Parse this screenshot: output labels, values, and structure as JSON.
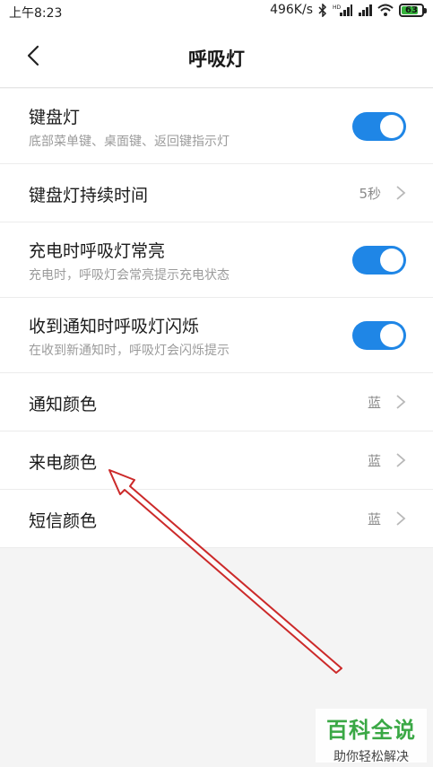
{
  "statusbar": {
    "time": "上午8:23",
    "speed": "496K/s",
    "battery": "63"
  },
  "header": {
    "title": "呼吸灯"
  },
  "settings": [
    {
      "label": "键盘灯",
      "desc": "底部菜单键、桌面键、返回键指示灯",
      "toggle_on": true
    },
    {
      "label": "键盘灯持续时间",
      "value": "5秒"
    },
    {
      "label": "充电时呼吸灯常亮",
      "desc": "充电时，呼吸灯会常亮提示充电状态",
      "toggle_on": true
    },
    {
      "label": "收到通知时呼吸灯闪烁",
      "desc": "在收到新通知时，呼吸灯会闪烁提示",
      "toggle_on": true
    },
    {
      "label": "通知颜色",
      "value": "蓝"
    },
    {
      "label": "来电颜色",
      "value": "蓝"
    },
    {
      "label": "短信颜色",
      "value": "蓝"
    }
  ],
  "colors": {
    "accent": "#1f86e6",
    "annotation_arrow": "#cc2a2a",
    "watermark_green": "#3aa845"
  },
  "watermark": {
    "line1": "百科全说",
    "line2": "助你轻松解决"
  }
}
